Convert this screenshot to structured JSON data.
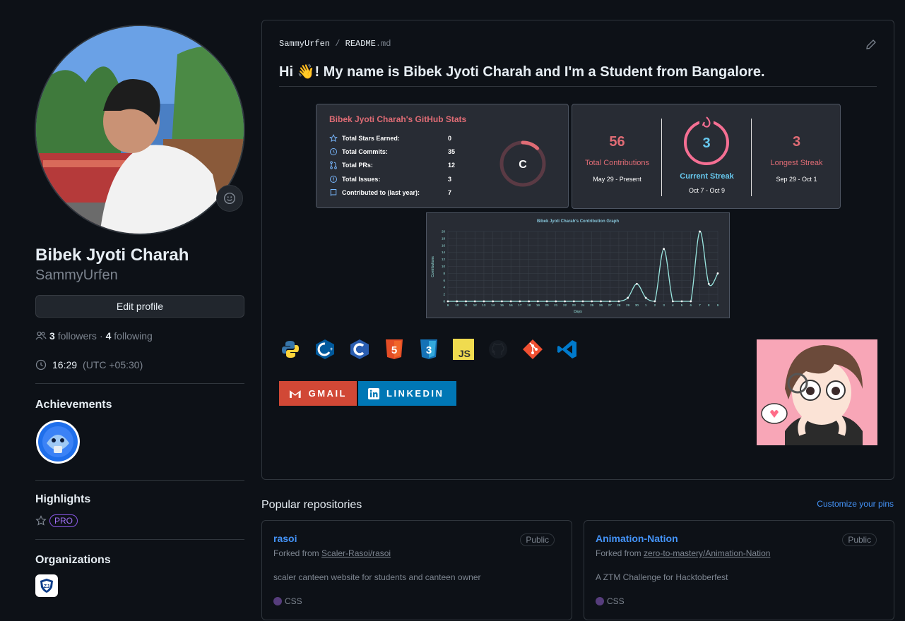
{
  "profile": {
    "name": "Bibek Jyoti Charah",
    "login": "SammyUrfen",
    "edit_label": "Edit profile",
    "followers_count": "3",
    "followers_label": "followers",
    "following_count": "4",
    "following_label": "following",
    "local_time": "16:29",
    "timezone": "(UTC +05:30)"
  },
  "sections": {
    "achievements": "Achievements",
    "highlights": "Highlights",
    "pro_label": "PRO",
    "organizations": "Organizations"
  },
  "readme": {
    "owner": "SammyUrfen",
    "file_name": "README",
    "file_ext": ".md",
    "heading_pre": "Hi ",
    "heading_post": "! My name is Bibek Jyoti Charah and I'm a Student from Bangalore.",
    "stats": {
      "title": "Bibek Jyoti Charah's GitHub Stats",
      "rows": [
        {
          "label": "Total Stars Earned:",
          "value": "0",
          "icon": "star-icon"
        },
        {
          "label": "Total Commits:",
          "value": "35",
          "icon": "history-icon"
        },
        {
          "label": "Total PRs:",
          "value": "12",
          "icon": "pull-request-icon"
        },
        {
          "label": "Total Issues:",
          "value": "3",
          "icon": "issue-icon"
        },
        {
          "label": "Contributed to (last year):",
          "value": "7",
          "icon": "repo-icon"
        }
      ],
      "grade": "C",
      "grade_progress": 0.12
    },
    "streak": {
      "total": "56",
      "total_label": "Total Contributions",
      "total_range": "May 29 - Present",
      "current": "3",
      "current_label": "Current Streak",
      "current_range": "Oct 7 - Oct 9",
      "longest": "3",
      "longest_label": "Longest Streak",
      "longest_range": "Sep 29 - Oct 1"
    },
    "techs": [
      "python-icon",
      "cplusplus-icon",
      "c-icon",
      "html5-icon",
      "css3-icon",
      "javascript-icon",
      "github-icon",
      "git-icon",
      "vscode-icon"
    ],
    "badges": {
      "gmail": "GMAIL",
      "linkedin": "LINKEDIN"
    }
  },
  "chart_data": {
    "type": "line",
    "title": "Bibek Jyoti Charah's Contribution Graph",
    "xlabel": "Days",
    "ylabel": "Contributions",
    "categories": [
      "9",
      "10",
      "11",
      "12",
      "13",
      "14",
      "15",
      "16",
      "17",
      "18",
      "19",
      "20",
      "21",
      "22",
      "23",
      "24",
      "25",
      "26",
      "27",
      "28",
      "29",
      "30",
      "1",
      "2",
      "3",
      "4",
      "5",
      "6",
      "7",
      "8",
      "9"
    ],
    "values": [
      0,
      0,
      0,
      0,
      0,
      0,
      0,
      0,
      0,
      0,
      0,
      0,
      0,
      0,
      0,
      0,
      0,
      0,
      0,
      0,
      1,
      5,
      1,
      0,
      15,
      0,
      0,
      0,
      20,
      5,
      8
    ],
    "ylim": [
      0,
      20
    ],
    "yticks": [
      0,
      2,
      4,
      6,
      8,
      10,
      12,
      14,
      16,
      18,
      20
    ],
    "grid": true,
    "colors": {
      "line": "#9ae6e0",
      "title": "#86c4d8",
      "point": "#ffffff"
    }
  },
  "repos_section": {
    "title": "Popular repositories",
    "customize": "Customize your pins",
    "repos": [
      {
        "name": "rasoi",
        "visibility": "Public",
        "fork_prefix": "Forked from ",
        "fork_source": "Scaler-Rasoi/rasoi",
        "description": "scaler canteen website for students and canteen owner",
        "language": "CSS"
      },
      {
        "name": "Animation-Nation",
        "visibility": "Public",
        "fork_prefix": "Forked from ",
        "fork_source": "zero-to-mastery/Animation-Nation",
        "description": "A ZTM Challenge for Hacktoberfest",
        "language": "CSS"
      }
    ]
  },
  "colors": {
    "accent": "#4493f8",
    "stats_title": "#e06c75",
    "streak_accent": "#f56f93",
    "current_streak": "#67c8ee"
  }
}
